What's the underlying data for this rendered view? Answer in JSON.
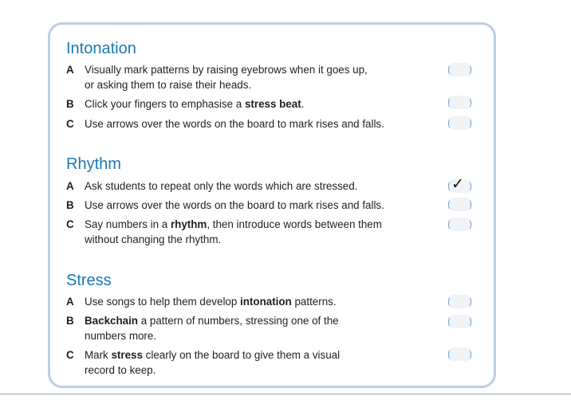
{
  "sections": [
    {
      "title": "Intonation",
      "items": [
        {
          "letter": "A",
          "line1_pre": "Visually mark patterns by raising eyebrows when it goes up,",
          "line1_bold": "",
          "line1_post": "",
          "line2": "or asking them to raise their heads.",
          "checked": false
        },
        {
          "letter": "B",
          "line1_pre": "Click your fingers to emphasise a ",
          "line1_bold": "stress beat",
          "line1_post": ".",
          "line2": "",
          "checked": false
        },
        {
          "letter": "C",
          "line1_pre": "Use arrows over the words on the board to mark rises and falls.",
          "line1_bold": "",
          "line1_post": "",
          "line2": "",
          "checked": false
        }
      ]
    },
    {
      "title": "Rhythm",
      "items": [
        {
          "letter": "A",
          "line1_pre": "Ask students to repeat only the words which are stressed.",
          "line1_bold": "",
          "line1_post": "",
          "line2": "",
          "checked": true
        },
        {
          "letter": "B",
          "line1_pre": "Use arrows over the words on the board to mark rises and falls.",
          "line1_bold": "",
          "line1_post": "",
          "line2": "",
          "checked": false
        },
        {
          "letter": "C",
          "line1_pre": "Say numbers in a ",
          "line1_bold": "rhythm",
          "line1_post": ", then introduce words between them",
          "line2": "without changing the rhythm.",
          "checked": false
        }
      ]
    },
    {
      "title": "Stress",
      "items": [
        {
          "letter": "A",
          "line1_pre": "Use songs to help them develop ",
          "line1_bold": "intonation",
          "line1_post": " patterns.",
          "line2": "",
          "checked": false
        },
        {
          "letter": "B",
          "line1_pre": "",
          "line1_bold": "Backchain",
          "line1_post": " a pattern of numbers, stressing one of the",
          "line2": "numbers more.",
          "checked": false
        },
        {
          "letter": "C",
          "line1_pre": "Mark ",
          "line1_bold": "stress",
          "line1_post": " clearly on the board to give them a visual",
          "line2": "record to keep.",
          "checked": false
        }
      ]
    }
  ],
  "tick_glyph": "✓"
}
